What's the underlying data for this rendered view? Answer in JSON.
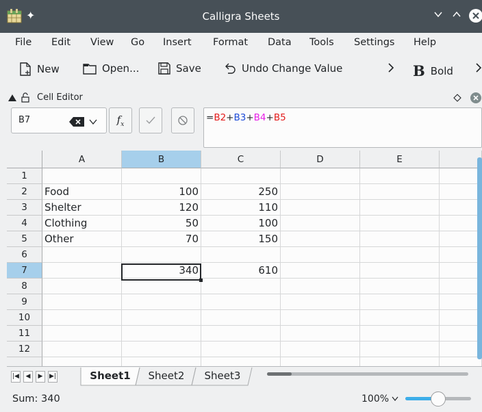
{
  "window": {
    "title": "Calligra Sheets"
  },
  "menu": [
    "File",
    "Edit",
    "View",
    "Go",
    "Insert",
    "Format",
    "Data",
    "Tools",
    "Settings",
    "Help"
  ],
  "toolbar": {
    "new": "New",
    "open": "Open...",
    "save": "Save",
    "undo": "Undo Change Value",
    "bold_glyph": "B",
    "bold": "Bold"
  },
  "editor": {
    "title": "Cell Editor",
    "cell_ref": "B7",
    "fx": "f",
    "fx_sub": "x"
  },
  "formula": [
    "=",
    "B2",
    "+",
    "B3",
    "+",
    "B4",
    "+",
    "B5"
  ],
  "formula_colors": [
    "#232629",
    "#e31a1a",
    "#232629",
    "#1d4bd7",
    "#232629",
    "#e61ee6",
    "#232629",
    "#e31a1a"
  ],
  "columns": [
    "A",
    "B",
    "C",
    "D",
    "E"
  ],
  "rows": [
    "1",
    "2",
    "3",
    "4",
    "5",
    "6",
    "7",
    "8",
    "9",
    "10",
    "11",
    "12"
  ],
  "cells": {
    "A2": "Food",
    "B2": "100",
    "C2": "250",
    "A3": "Shelter",
    "B3": "120",
    "C3": "110",
    "A4": "Clothing",
    "B4": "50",
    "C4": "100",
    "A5": "Other",
    "B5": "70",
    "C5": "150",
    "B7": "340",
    "C7": "610"
  },
  "selected": {
    "col": "B",
    "row": "7"
  },
  "sheets": [
    "Sheet1",
    "Sheet2",
    "Sheet3"
  ],
  "active_sheet": "Sheet1",
  "status": {
    "sum": "Sum: 340",
    "zoom": "100%",
    "zoom_level": 0.5
  },
  "colors": {
    "titlebar": "#475057",
    "selection": "#a6cfeb",
    "accent": "#3daee9"
  }
}
